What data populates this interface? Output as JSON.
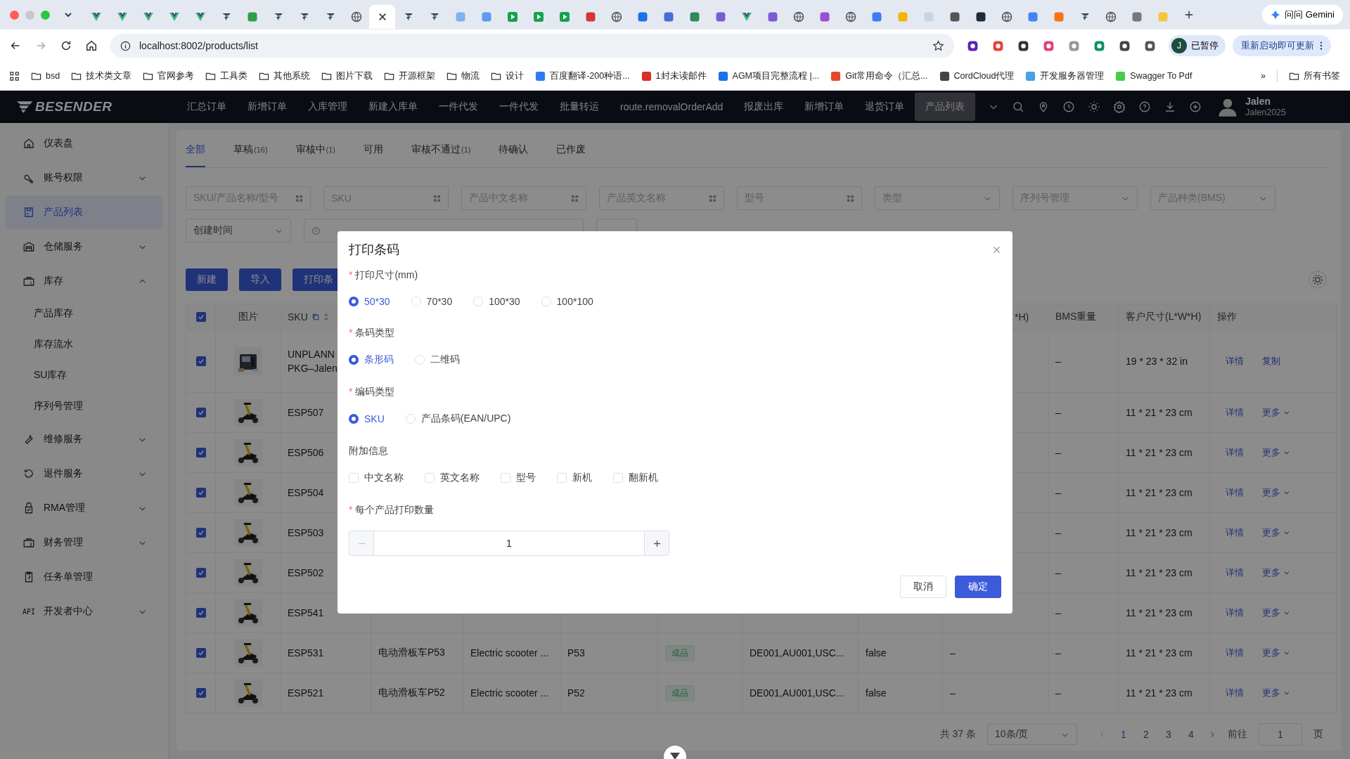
{
  "browser": {
    "tabs": [
      {
        "kind": "vue",
        "selected": false
      },
      {
        "kind": "vue",
        "selected": false
      },
      {
        "kind": "vue",
        "selected": false
      },
      {
        "kind": "vue",
        "selected": false
      },
      {
        "kind": "vue",
        "selected": false
      },
      {
        "kind": "arrow",
        "selected": false
      },
      {
        "kind": "app",
        "color": "#2f9e44",
        "selected": false
      },
      {
        "kind": "arrow",
        "selected": false
      },
      {
        "kind": "arrow",
        "selected": false
      },
      {
        "kind": "arrow",
        "selected": false
      },
      {
        "kind": "globe",
        "selected": false
      },
      {
        "selected": true
      },
      {
        "kind": "arrow",
        "selected": false
      },
      {
        "kind": "arrow",
        "selected": false
      },
      {
        "kind": "app",
        "color": "#7fb3ee",
        "selected": false
      },
      {
        "kind": "app",
        "color": "#5b9bf0",
        "selected": false
      },
      {
        "kind": "play",
        "selected": false
      },
      {
        "kind": "play",
        "selected": false
      },
      {
        "kind": "play",
        "selected": false
      },
      {
        "kind": "app",
        "color": "#d6333a",
        "selected": false
      },
      {
        "kind": "globe",
        "selected": false
      },
      {
        "kind": "app",
        "color": "#1a73e8",
        "selected": false
      },
      {
        "kind": "app",
        "color": "#4b6bd6",
        "selected": false
      },
      {
        "kind": "app",
        "color": "#2e8b57",
        "selected": false
      },
      {
        "kind": "app",
        "color": "#7b5cd6",
        "selected": false
      },
      {
        "kind": "vue",
        "selected": false
      },
      {
        "kind": "app",
        "color": "#7b5cd6",
        "selected": false
      },
      {
        "kind": "globe",
        "selected": false
      },
      {
        "kind": "app",
        "color": "#9b4fd1",
        "selected": false
      },
      {
        "kind": "globe",
        "selected": false
      },
      {
        "kind": "app",
        "color": "#3b7cf5",
        "selected": false
      },
      {
        "kind": "app",
        "color": "#f4b400",
        "selected": false
      },
      {
        "kind": "app",
        "color": "#c9d3e6",
        "selected": false
      },
      {
        "kind": "app",
        "color": "#555555",
        "selected": false
      },
      {
        "kind": "app",
        "color": "#1f2937",
        "selected": false
      },
      {
        "kind": "globe",
        "selected": false
      },
      {
        "kind": "app",
        "color": "#4285f4",
        "selected": false
      },
      {
        "kind": "app",
        "color": "#f97316",
        "selected": false
      },
      {
        "kind": "arrow",
        "selected": false
      },
      {
        "kind": "globe",
        "selected": false
      },
      {
        "kind": "app",
        "color": "#777777",
        "selected": false
      },
      {
        "kind": "app",
        "color": "#f5c542",
        "selected": false
      }
    ],
    "gemini": "问问 Gemini",
    "url": "localhost:8002/products/list",
    "profile_initial": "J",
    "profile_status": "已暂停",
    "update_button": "重新启动即可更新",
    "bookmarks": [
      {
        "label": "bsd",
        "kind": "folder"
      },
      {
        "label": "技术类文章",
        "kind": "folder"
      },
      {
        "label": "官网参考",
        "kind": "folder"
      },
      {
        "label": "工具类",
        "kind": "folder"
      },
      {
        "label": "其他系统",
        "kind": "folder"
      },
      {
        "label": "图片下载",
        "kind": "folder"
      },
      {
        "label": "开源框架",
        "kind": "folder"
      },
      {
        "label": "物流",
        "kind": "folder"
      },
      {
        "label": "设计",
        "kind": "folder"
      },
      {
        "label": "百度翻译-200种语...",
        "kind": "site",
        "color": "#2f7bf6"
      },
      {
        "label": "1封未读邮件",
        "kind": "site",
        "color": "#d93025"
      },
      {
        "label": "AGM项目完整流程 |...",
        "kind": "site",
        "color": "#1a73e8"
      },
      {
        "label": "Git常用命令（汇总...",
        "kind": "site",
        "color": "#e5482d"
      },
      {
        "label": "CordCloud代理",
        "kind": "site",
        "color": "#444444"
      },
      {
        "label": "开发服务器管理",
        "kind": "site",
        "color": "#49a0e6"
      },
      {
        "label": "Swagger To Pdf",
        "kind": "site",
        "color": "#49cc4e"
      }
    ],
    "bookmarks_more": "»",
    "all_bookmarks": "所有书签"
  },
  "app": {
    "logo": "BESENDER",
    "nav": [
      {
        "label": "汇总订单",
        "selected": false
      },
      {
        "label": "新增订单",
        "selected": false
      },
      {
        "label": "入库管理",
        "selected": false
      },
      {
        "label": "新建入库单",
        "selected": false
      },
      {
        "label": "一件代发",
        "selected": false
      },
      {
        "label": "一件代发",
        "selected": false
      },
      {
        "label": "批量转运",
        "selected": false
      },
      {
        "label": "route.removalOrderAdd",
        "selected": false
      },
      {
        "label": "报废出库",
        "selected": false
      },
      {
        "label": "新增订单",
        "selected": false
      },
      {
        "label": "退货订单",
        "selected": false
      },
      {
        "label": "产品列表",
        "selected": true
      }
    ],
    "user": {
      "name": "Jalen",
      "account": "Jalen2025"
    }
  },
  "sidebar": [
    {
      "label": "仪表盘",
      "kind": "link",
      "selected": false
    },
    {
      "label": "账号权限",
      "kind": "group",
      "expanded": false,
      "selected": false
    },
    {
      "label": "产品列表",
      "kind": "link",
      "selected": true
    },
    {
      "label": "仓储服务",
      "kind": "group",
      "expanded": false,
      "selected": false
    },
    {
      "label": "库存",
      "kind": "group",
      "expanded": true,
      "selected": false,
      "children": [
        {
          "label": "产品库存"
        },
        {
          "label": "库存流水"
        },
        {
          "label": "SU库存"
        },
        {
          "label": "序列号管理"
        }
      ]
    },
    {
      "label": "维修服务",
      "kind": "group",
      "expanded": false,
      "selected": false
    },
    {
      "label": "退件服务",
      "kind": "group",
      "expanded": false,
      "selected": false
    },
    {
      "label": "RMA管理",
      "kind": "group",
      "expanded": false,
      "selected": false
    },
    {
      "label": "财务管理",
      "kind": "group",
      "expanded": false,
      "selected": false
    },
    {
      "label": "任务单管理",
      "kind": "link",
      "selected": false
    },
    {
      "label": "开发者中心",
      "kind": "group",
      "expanded": false,
      "selected": false,
      "icon_text": "API"
    }
  ],
  "status_tabs": [
    {
      "label": "全部",
      "selected": true
    },
    {
      "label": "草稿",
      "count": "(16)",
      "selected": false
    },
    {
      "label": "审核中",
      "count": "(1)",
      "selected": false
    },
    {
      "label": "可用",
      "selected": false
    },
    {
      "label": "审核不通过",
      "count": "(1)",
      "selected": false
    },
    {
      "label": "待确认",
      "selected": false
    },
    {
      "label": "已作废",
      "selected": false
    }
  ],
  "filters": [
    {
      "placeholder": "SKU/产品名称/型号",
      "kind": "input"
    },
    {
      "placeholder": "SKU",
      "kind": "input"
    },
    {
      "placeholder": "产品中文名称",
      "kind": "input"
    },
    {
      "placeholder": "产品英文名称",
      "kind": "input"
    },
    {
      "placeholder": "型号",
      "kind": "input"
    },
    {
      "placeholder": "类型",
      "kind": "select"
    },
    {
      "placeholder": "序列号管理",
      "kind": "select"
    },
    {
      "placeholder": "产品种类(BMS)",
      "kind": "select"
    },
    {
      "placeholder": "创建时间",
      "kind": "select"
    }
  ],
  "actions": [
    "新建",
    "导入",
    "打印条"
  ],
  "table": {
    "select_all": true,
    "image": "图片",
    "sku": "SKU",
    "dims_tail": "*H)",
    "bms_weight": "BMS重量",
    "customer_size": "客户尺寸(L*W*H)",
    "actions": "操作",
    "rows": [
      {
        "checked": true,
        "kind": "device",
        "sku": "UNPLANN",
        "sku_line2": "PKG–Jalen",
        "bms_weight": "–",
        "size": "19 * 23 * 32 in",
        "actions": [
          {
            "label": "详情",
            "menu": false
          },
          {
            "label": "复制",
            "menu": false
          }
        ]
      },
      {
        "checked": true,
        "kind": "scooter",
        "sku": "ESP507",
        "bms_weight": "–",
        "size": "11 * 21 * 23 cm",
        "actions": [
          {
            "label": "详情",
            "menu": false
          },
          {
            "label": "更多",
            "menu": true
          }
        ]
      },
      {
        "checked": true,
        "kind": "scooter",
        "sku": "ESP506",
        "bms_weight": "–",
        "size": "11 * 21 * 23 cm",
        "actions": [
          {
            "label": "详情",
            "menu": false
          },
          {
            "label": "更多",
            "menu": true
          }
        ]
      },
      {
        "checked": true,
        "kind": "scooter",
        "sku": "ESP504",
        "bms_weight": "–",
        "size": "11 * 21 * 23 cm",
        "actions": [
          {
            "label": "详情",
            "menu": false
          },
          {
            "label": "更多",
            "menu": true
          }
        ]
      },
      {
        "checked": true,
        "kind": "scooter",
        "sku": "ESP503",
        "bms_weight": "–",
        "size": "11 * 21 * 23 cm",
        "actions": [
          {
            "label": "详情",
            "menu": false
          },
          {
            "label": "更多",
            "menu": true
          }
        ]
      },
      {
        "checked": true,
        "kind": "scooter",
        "sku": "ESP502",
        "bms_weight": "–",
        "size": "11 * 21 * 23 cm",
        "actions": [
          {
            "label": "详情",
            "menu": false
          },
          {
            "label": "更多",
            "menu": true
          }
        ]
      },
      {
        "checked": true,
        "kind": "scooter",
        "sku": "ESP541",
        "bms_weight": "–",
        "size": "11 * 21 * 23 cm",
        "actions": [
          {
            "label": "详情",
            "menu": false
          },
          {
            "label": "更多",
            "menu": true
          }
        ]
      },
      {
        "checked": true,
        "kind": "scooter",
        "sku": "ESP531",
        "name_cn": "电动滑板车P53",
        "name_en": "Electric scooter ...",
        "model": "P53",
        "type": "成品",
        "codes": "DE001,AU001,USC...",
        "flag": "false",
        "dims": "–",
        "bms_weight": "–",
        "size": "11 * 21 * 23 cm",
        "actions": [
          {
            "label": "详情",
            "menu": false
          },
          {
            "label": "更多",
            "menu": true
          }
        ]
      },
      {
        "checked": true,
        "kind": "scooter",
        "sku": "ESP521",
        "name_cn": "电动滑板车P52",
        "name_en": "Electric scooter ...",
        "model": "P52",
        "type": "成品",
        "codes": "DE001,AU001,USC...",
        "flag": "false",
        "dims": "–",
        "bms_weight": "–",
        "size": "11 * 21 * 23 cm",
        "actions": [
          {
            "label": "详情",
            "menu": false
          },
          {
            "label": "更多",
            "menu": true
          }
        ]
      }
    ]
  },
  "pagination": {
    "total": "共 37 条",
    "page_size": "10条/页",
    "pages": [
      {
        "label": "1",
        "selected": true
      },
      {
        "label": "2",
        "selected": false
      },
      {
        "label": "3",
        "selected": false
      },
      {
        "label": "4",
        "selected": false
      }
    ],
    "goto_label": "前往",
    "goto_value": "1",
    "goto_suffix": "页"
  },
  "dialog": {
    "title": "打印条码",
    "sections": [
      {
        "label": "打印尺寸(mm)",
        "required_mark": "*",
        "kind": "radio",
        "options": [
          {
            "label": "50*30",
            "selected": true
          },
          {
            "label": "70*30",
            "selected": false
          },
          {
            "label": "100*30",
            "selected": false
          },
          {
            "label": "100*100",
            "selected": false
          }
        ]
      },
      {
        "label": "条码类型",
        "required_mark": "*",
        "kind": "radio",
        "options": [
          {
            "label": "条形码",
            "selected": true
          },
          {
            "label": "二维码",
            "selected": false
          }
        ]
      },
      {
        "label": "编码类型",
        "required_mark": "*",
        "kind": "radio",
        "options": [
          {
            "label": "SKU",
            "selected": true
          },
          {
            "label": "产品条码(EAN/UPC)",
            "selected": false
          }
        ]
      },
      {
        "label": "附加信息",
        "kind": "checkbox",
        "options": [
          {
            "label": "中文名称",
            "checked": false
          },
          {
            "label": "英文名称",
            "checked": false
          },
          {
            "label": "型号",
            "checked": false
          },
          {
            "label": "新机",
            "checked": false
          },
          {
            "label": "翻新机",
            "checked": false
          }
        ]
      },
      {
        "label": "每个产品打印数量",
        "required_mark": "*",
        "kind": "stepper",
        "value": "1",
        "minus_disabled": true
      }
    ],
    "buttons": [
      {
        "label": "取消",
        "kind": "secondary"
      },
      {
        "label": "确定",
        "kind": "primary"
      }
    ]
  }
}
